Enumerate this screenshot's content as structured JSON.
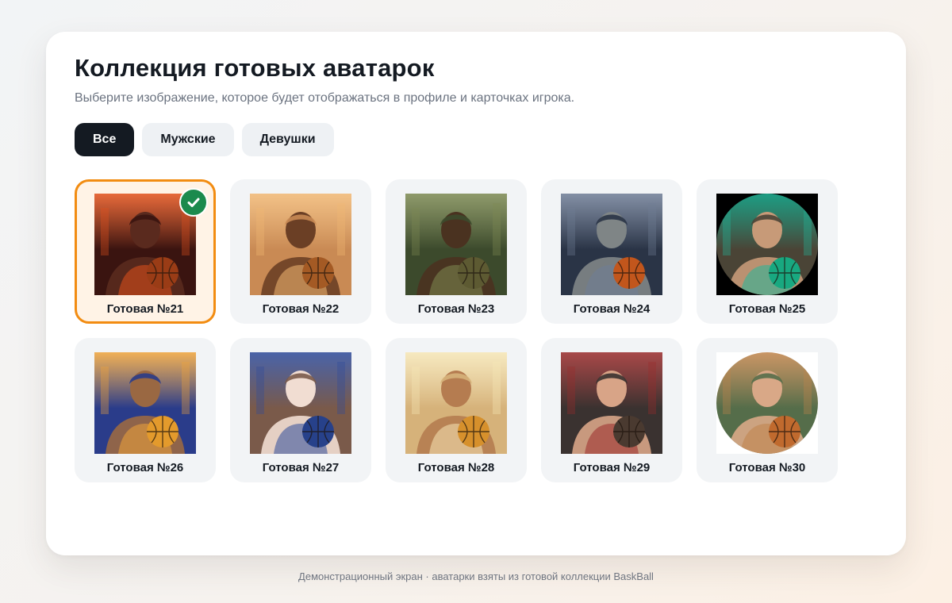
{
  "header": {
    "title": "Коллекция готовых аватарок",
    "subtitle": "Выберите изображение, которое будет отображаться в профиле и карточках игрока."
  },
  "filters": [
    {
      "label": "Все",
      "active": true
    },
    {
      "label": "Мужские",
      "active": false
    },
    {
      "label": "Девушки",
      "active": false
    }
  ],
  "avatars": [
    {
      "label": "Готовая №21",
      "selected": true,
      "bg": "#3a1410",
      "accent": "#e2511c",
      "skin": "#5a2a1e",
      "ball": "#9a3c16",
      "shape": "square",
      "icon": "lava-warrior"
    },
    {
      "label": "Готовая №22",
      "selected": false,
      "bg": "#c98a54",
      "accent": "#f2b873",
      "skin": "#6b3f25",
      "ball": "#a45a24",
      "shape": "square",
      "icon": "aviator-player"
    },
    {
      "label": "Готовая №23",
      "selected": false,
      "bg": "#3c4a2c",
      "accent": "#7d8a52",
      "skin": "#4a3220",
      "ball": "#5d5a32",
      "shape": "square",
      "icon": "armored-knight"
    },
    {
      "label": "Готовая №24",
      "selected": false,
      "bg": "#2a3446",
      "accent": "#6f7d96",
      "skin": "#7f8586",
      "ball": "#c2561c",
      "shape": "square",
      "icon": "gargoyle-player"
    },
    {
      "label": "Готовая №25",
      "selected": false,
      "bg": "#4a4436",
      "accent": "#22b89a",
      "skin": "#c79a78",
      "ball": "#18a880",
      "shape": "round-dark",
      "icon": "steampunk-player"
    },
    {
      "label": "Готовая №26",
      "selected": false,
      "bg": "#2a3c8a",
      "accent": "#f0a43a",
      "skin": "#9a6842",
      "ball": "#e39a2c",
      "shape": "square",
      "icon": "blue-hair-girl"
    },
    {
      "label": "Готовая №27",
      "selected": false,
      "bg": "#7a5a4a",
      "accent": "#2d4a9a",
      "skin": "#f1ddd2",
      "ball": "#27418a",
      "shape": "square",
      "icon": "porcelain-girl"
    },
    {
      "label": "Готовая №28",
      "selected": false,
      "bg": "#d6b27a",
      "accent": "#f7e7b6",
      "skin": "#b57c50",
      "ball": "#d6902c",
      "shape": "square",
      "icon": "goddess-girl"
    },
    {
      "label": "Готовая №29",
      "selected": false,
      "bg": "#3a3230",
      "accent": "#9a2a2a",
      "skin": "#d8a487",
      "ball": "#4a3a30",
      "shape": "square",
      "icon": "red-jacket-girl"
    },
    {
      "label": "Готовая №30",
      "selected": false,
      "bg": "#556d4a",
      "accent": "#c0834a",
      "skin": "#d9a887",
      "ball": "#c06a2e",
      "shape": "round",
      "icon": "hat-girl"
    }
  ],
  "footer": "Демонстрационный экран · аватарки взяты из готовой коллекции BaskBall",
  "colors": {
    "accent_selected": "#f28c11",
    "check_green": "#1b8a4d",
    "dark": "#141a22"
  }
}
